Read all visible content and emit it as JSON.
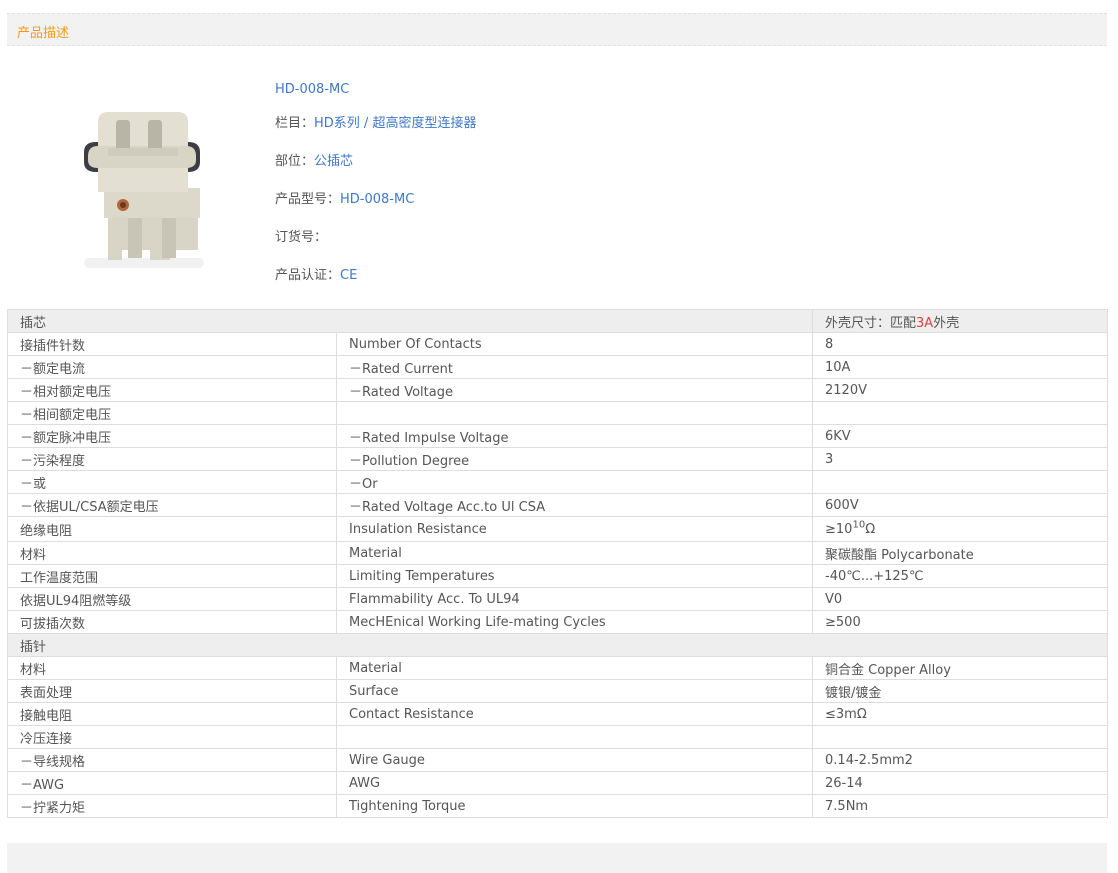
{
  "section_title": "产品描述",
  "product": {
    "name": "HD-008-MC",
    "category_label": "栏目：",
    "category_path": "HD系列 / 超高密度型连接器",
    "part_label": "部位：",
    "part_value": "公插芯",
    "model_label": "产品型号：",
    "model_value": "HD-008-MC",
    "order_label": "订货号：",
    "order_value": "",
    "cert_label": "产品认证：",
    "cert_value": "CE"
  },
  "insert_header": {
    "label": "插芯",
    "shell_prefix": "外壳尺寸：匹配",
    "shell_size": "3A",
    "shell_suffix": "外壳"
  },
  "insert_rows": [
    {
      "cn": "接插件针数",
      "en": "Number Of Contacts",
      "value": "8"
    },
    {
      "cn": "－额定电流",
      "en": "－Rated Current",
      "value": "10A"
    },
    {
      "cn": "－相对额定电压",
      "en": "－Rated Voltage",
      "value": "2120V"
    },
    {
      "cn": "－相间额定电压",
      "en": "",
      "value": ""
    },
    {
      "cn": "－额定脉冲电压",
      "en": "－Rated Impulse Voltage",
      "value": "6KV"
    },
    {
      "cn": "－污染程度",
      "en": "－Pollution Degree",
      "value": "3"
    },
    {
      "cn": "－或",
      "en": "－Or",
      "value": ""
    },
    {
      "cn": "－依据UL/CSA额定电压",
      "en": "－Rated Voltage Acc.to Ul CSA",
      "value": "600V"
    }
  ],
  "insulation_row": {
    "cn": "绝缘电阻",
    "en": "Insulation Resistance",
    "value_base": "≥10",
    "value_exp": "10",
    "value_unit": "Ω"
  },
  "insert_rows_2": [
    {
      "cn": "材料",
      "en": "Material",
      "value": "聚碳酸酯 Polycarbonate"
    },
    {
      "cn": "工作温度范围",
      "en": "Limiting Temperatures",
      "value": "-40℃...+125℃"
    },
    {
      "cn": "依据UL94阻燃等级",
      "en": "Flammability Acc. To UL94",
      "value": "V0"
    },
    {
      "cn": "可拔插次数",
      "en": "MecHEnical Working Life-mating Cycles",
      "value": "≥500"
    }
  ],
  "pin_header": {
    "label": "插针"
  },
  "pin_rows": [
    {
      "cn": "材料",
      "en": "Material",
      "value": "铜合金 Copper Alloy"
    },
    {
      "cn": "表面处理",
      "en": "Surface",
      "value": "镀银/镀金"
    },
    {
      "cn": "接触电阻",
      "en": "Contact Resistance",
      "value": "≤3mΩ"
    },
    {
      "cn": "冷压连接",
      "en": "",
      "value": ""
    },
    {
      "cn": "－导线规格",
      "en": "Wire Gauge",
      "value": "0.14-2.5mm2"
    },
    {
      "cn": "－AWG",
      "en": "AWG",
      "value": "26-14"
    },
    {
      "cn": "－拧紧力矩",
      "en": "Tightening Torque",
      "value": "7.5Nm"
    }
  ],
  "colors": {
    "accent_orange": "#f39c12",
    "link_blue": "#3f78c8",
    "highlight_red": "#e43c3c"
  }
}
